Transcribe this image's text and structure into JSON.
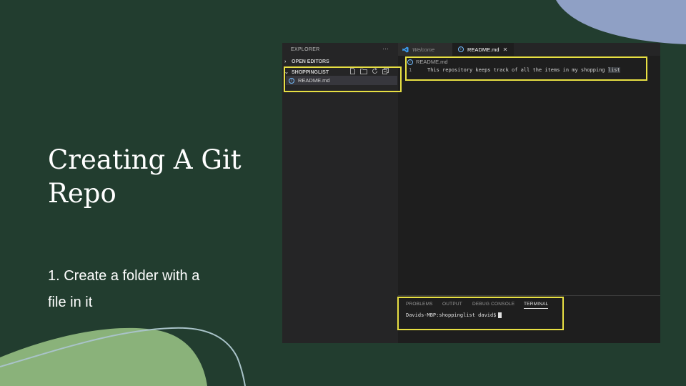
{
  "slide": {
    "title_lines": [
      "Creating A Git",
      "Repo"
    ],
    "bullet_lines": [
      "1. Create a folder with a",
      "file in it"
    ]
  },
  "colors": {
    "background": "#223d2f",
    "blob_topright": "#8fa0c5",
    "blob_bottomleft": "#8ab27a",
    "curve_line": "#a9c3c9",
    "highlight": "#e8e043"
  },
  "vscode": {
    "sidebar": {
      "header": "EXPLORER",
      "more_icon": "ellipsis-icon",
      "open_editors_label": "OPEN EDITORS",
      "folder_label": "SHOPPINGLIST",
      "action_icons": [
        "new-file-icon",
        "new-folder-icon",
        "refresh-icon",
        "collapse-all-icon"
      ],
      "files": [
        {
          "name": "README.md",
          "icon": "info-icon"
        }
      ]
    },
    "tabs": [
      {
        "label": "Welcome",
        "icon": "vscode-logo-icon",
        "active": false
      },
      {
        "label": "README.md",
        "icon": "info-icon",
        "active": true
      }
    ],
    "editor": {
      "breadcrumb": "README.md",
      "line_number": "1",
      "code_text": "This repository keeps track of all the items in my shopping ",
      "code_selected_word": "list"
    },
    "panel": {
      "tabs": [
        "PROBLEMS",
        "OUTPUT",
        "DEBUG CONSOLE",
        "TERMINAL"
      ],
      "active_tab": "TERMINAL",
      "terminal_prompt": "Davids-MBP:shoppinglist david$"
    }
  }
}
